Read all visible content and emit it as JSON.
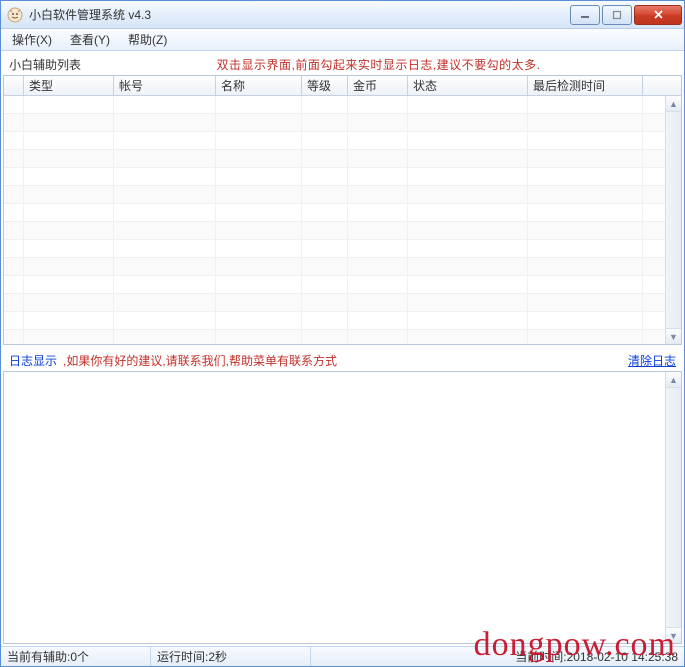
{
  "window": {
    "title": "小白软件管理系统   v4.3"
  },
  "menu": {
    "operate": "操作(X)",
    "view": "查看(Y)",
    "help": "帮助(Z)"
  },
  "upper": {
    "list_title": "小白辅助列表",
    "hint": "双击显示界面,前面勾起来实时显示日志,建议不要勾的太多.",
    "columns": {
      "type": "类型",
      "account": "帐号",
      "name": "名称",
      "level": "等级",
      "gold": "金币",
      "status": "状态",
      "last_check": "最后检测时间"
    }
  },
  "lower": {
    "log_title": "日志显示",
    "suggest": ",如果你有好的建议,请联系我们,帮助菜单有联系方式",
    "clear": "清除日志"
  },
  "statusbar": {
    "helper_count": "当前有辅助:0个",
    "runtime": "运行时间:2秒",
    "current_time": "当前时间:2018-02-10 14:25:38"
  },
  "watermark": "dongpow.com"
}
